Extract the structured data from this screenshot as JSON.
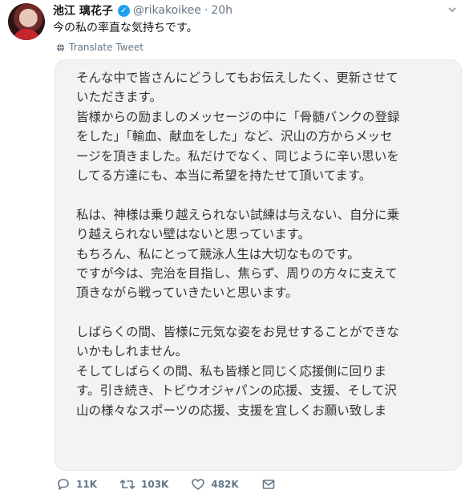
{
  "tweet": {
    "author_name": "池江 璃花子",
    "handle": "@rikakoikee",
    "separator": "·",
    "time": "20h",
    "text": "今の私の率直な気持ちです。",
    "translate_label": "Translate Tweet",
    "image_text_lines": [
      "そんな中で皆さんにどうしてもお伝えしたく、更新させて",
      "いただきます。",
      "皆様からの励ましのメッセージの中に「骨髄バンクの登録",
      "をした」「輸血、献血をした」など、沢山の方からメッセ",
      "ージを頂きました。私だけでなく、同じように辛い思いを",
      "してる方達にも、本当に希望を持たせて頂いてます。",
      "",
      "私は、神様は乗り越えられない試練は与えない、自分に乗",
      "り越えられない壁はないと思っています。",
      "もちろん、私にとって競泳人生は大切なものです。",
      "ですが今は、完治を目指し、焦らず、周りの方々に支えて",
      "頂きながら戦っていきたいと思います。",
      "",
      "しばらくの間、皆様に元気な姿をお見せすることができな",
      "いかもしれません。",
      "そしてしばらくの間、私も皆様と同じく応援側に回りま",
      "す。引き続き、トビウオジャパンの応援、支援、そして沢",
      "山の様々なスポーツの応援、支援を宜しくお願い致しま"
    ],
    "stats": {
      "replies": "11K",
      "retweets": "103K",
      "likes": "482K"
    }
  },
  "icons": {
    "verified": "verified-badge-icon",
    "reply": "reply-icon",
    "retweet": "retweet-icon",
    "like": "heart-icon",
    "message": "envelope-icon",
    "translate": "globe-icon",
    "more": "chevron-down-icon"
  },
  "colors": {
    "verified": "#1da1f2",
    "muted": "#657786",
    "card_bg": "#f3f3f3"
  }
}
